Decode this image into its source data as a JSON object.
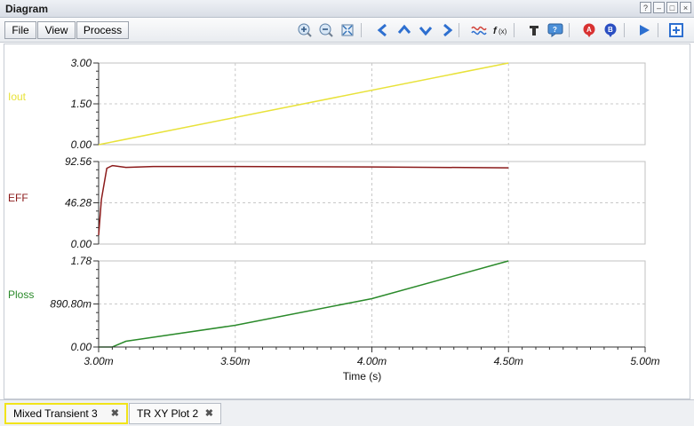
{
  "window": {
    "title": "Diagram",
    "controls": [
      "?",
      "–",
      "□",
      "×"
    ]
  },
  "menu": {
    "file": "File",
    "view": "View",
    "process": "Process"
  },
  "toolbar_icons": [
    "zoom-in-icon",
    "zoom-out-icon",
    "zoom-fit-icon",
    "pan-left-icon",
    "pan-up-icon",
    "pan-down-icon",
    "pan-right-icon",
    "waveform-icon",
    "function-icon",
    "text-icon",
    "comment-icon",
    "marker-a-icon",
    "marker-b-icon",
    "play-icon",
    "add-icon"
  ],
  "colors": {
    "iout": "#e8e23a",
    "eff": "#8b1a1a",
    "ploss": "#2a8a2a",
    "grid": "#c8c8c8",
    "tab_highlight": "#f1e41a"
  },
  "plots": [
    {
      "name": "Iout",
      "ticks": [
        "3.00",
        "1.50",
        "0.00"
      ]
    },
    {
      "name": "EFF",
      "ticks": [
        "92.56",
        "46.28",
        "0.00"
      ]
    },
    {
      "name": "Ploss",
      "ticks": [
        "1.78",
        "890.80m",
        "0.00"
      ]
    }
  ],
  "x_axis": {
    "label": "Time (s)",
    "ticks": [
      "3.00m",
      "3.50m",
      "4.00m",
      "4.50m",
      "5.00m"
    ]
  },
  "chart_data": [
    {
      "type": "line",
      "series": [
        {
          "name": "Iout",
          "x": [
            0.003,
            0.0045
          ],
          "y": [
            0.0,
            3.0
          ]
        }
      ],
      "xlim": [
        0.003,
        0.005
      ],
      "ylim": [
        0,
        3.0
      ]
    },
    {
      "type": "line",
      "series": [
        {
          "name": "EFF",
          "x": [
            0.003,
            0.00301,
            0.00303,
            0.00305,
            0.0031,
            0.0032,
            0.0035,
            0.004,
            0.0045
          ],
          "y": [
            10,
            50,
            85,
            88,
            86,
            87,
            87,
            86.5,
            85.5
          ]
        }
      ],
      "xlim": [
        0.003,
        0.005
      ],
      "ylim": [
        0,
        92.56
      ]
    },
    {
      "type": "line",
      "series": [
        {
          "name": "Ploss",
          "x": [
            0.003,
            0.00305,
            0.0031,
            0.0035,
            0.004,
            0.0045
          ],
          "y": [
            0.0,
            0.0,
            0.12,
            0.45,
            1.0,
            1.78
          ]
        }
      ],
      "xlim": [
        0.003,
        0.005
      ],
      "ylim": [
        0,
        1.78
      ]
    }
  ],
  "tabs": [
    {
      "label": "Mixed Transient 3",
      "active": true
    },
    {
      "label": "TR XY Plot 2",
      "active": false
    }
  ]
}
